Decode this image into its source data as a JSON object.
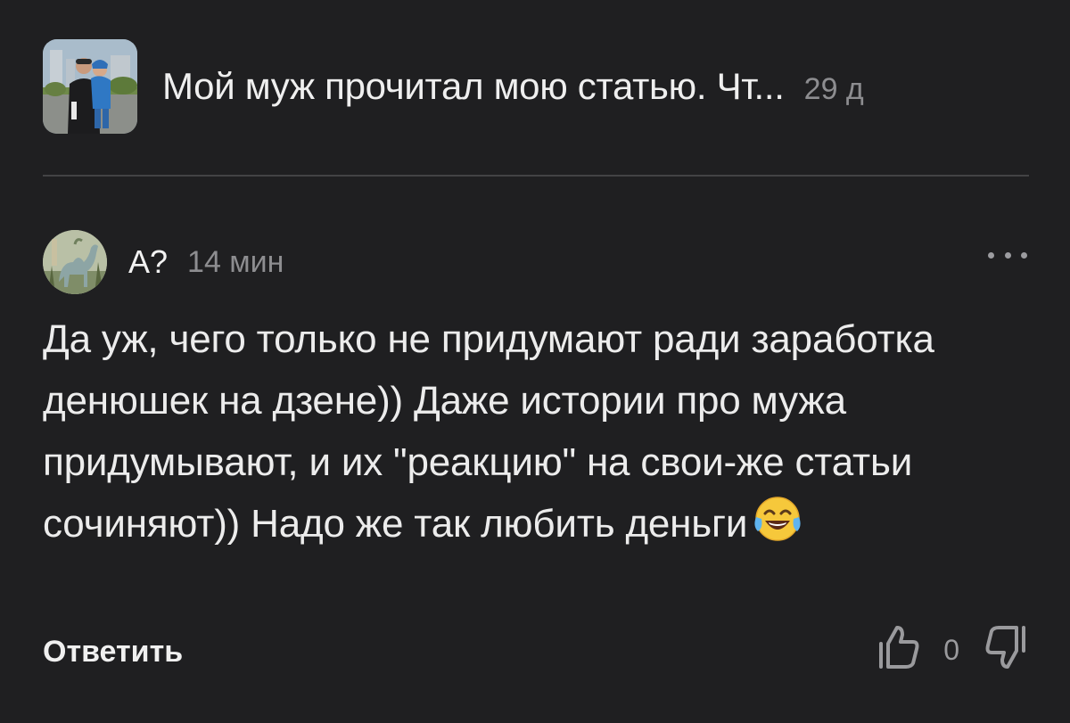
{
  "article": {
    "title": "Мой муж прочитал мою статью. Чт...",
    "age": "29 д",
    "thumbnail_icon": "article-photo"
  },
  "comment": {
    "author": "А?",
    "time": "14 мин",
    "avatar_icon": "camel-avatar",
    "text": "Да уж, чего только не придумают ради заработка денюшек на дзене)) Даже истории про мужа придумывают, и их \"реакцию\" на свои-же статьи сочиняют)) Надо же так любить деньги",
    "emoji": "face-with-tears-of-joy",
    "reply_label": "Ответить",
    "likes": "0",
    "more_icon": "more-dots-icon"
  },
  "colors": {
    "background": "#1f1f21",
    "text": "#ececec",
    "muted": "#8d8d90",
    "divider": "#434345"
  }
}
